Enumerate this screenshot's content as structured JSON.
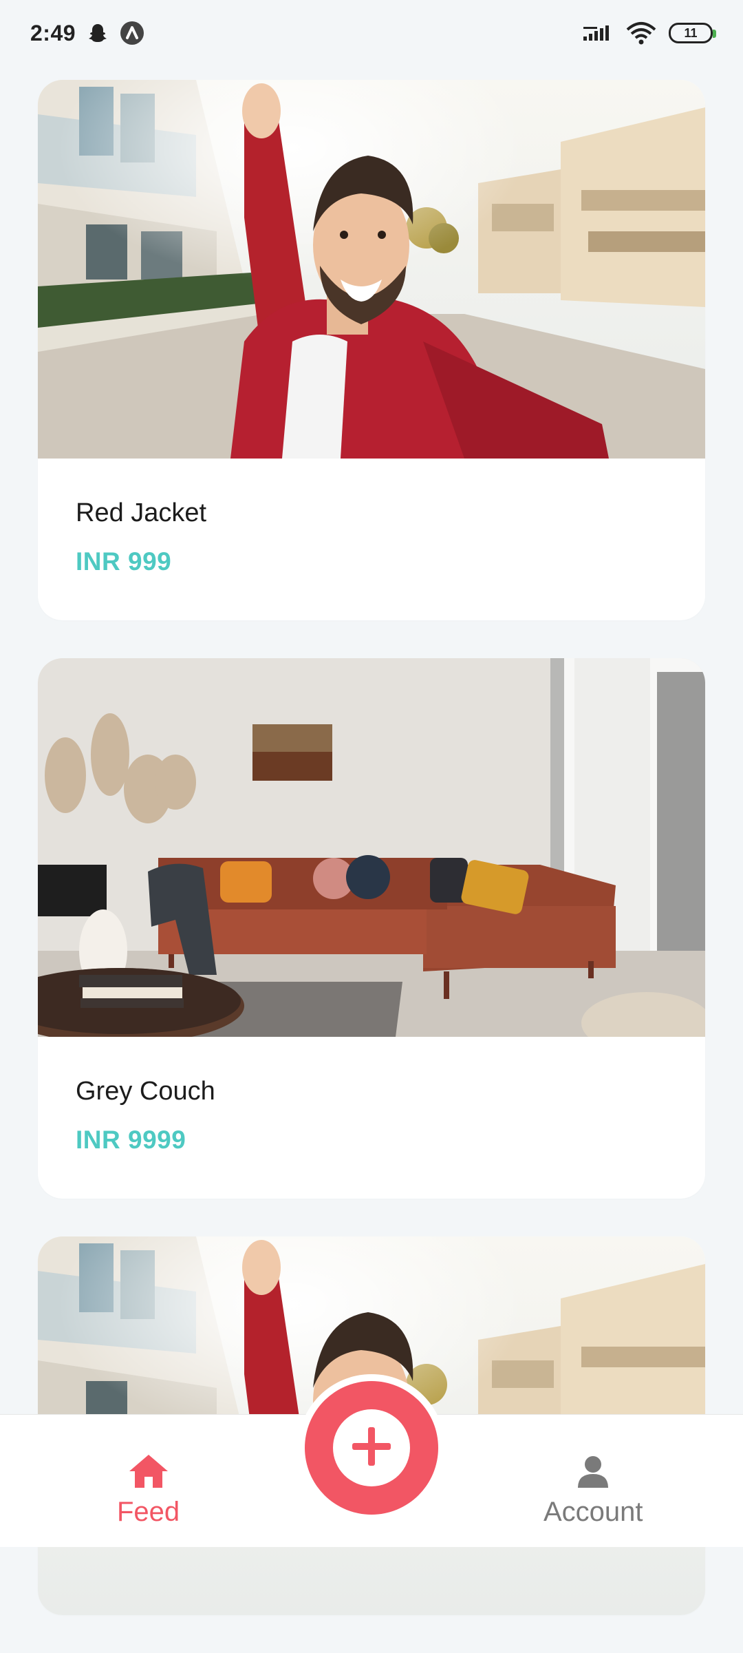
{
  "status_bar": {
    "time": "2:49",
    "battery_level": "11",
    "icons": [
      "snapchat-ghost-icon",
      "app-notification-icon",
      "signal-icon",
      "wifi-icon",
      "battery-icon"
    ]
  },
  "feed": {
    "items": [
      {
        "title": "Red Jacket",
        "price": "INR 999",
        "image": "man-red-jacket-selfie-photo"
      },
      {
        "title": "Grey Couch",
        "price": "INR 9999",
        "image": "living-room-couch-photo"
      },
      {
        "title": "",
        "price": "",
        "image": "man-red-jacket-selfie-photo"
      }
    ]
  },
  "bottom_nav": {
    "feed_label": "Feed",
    "account_label": "Account",
    "active_color": "#f25664",
    "inactive_color": "#7a7a7a"
  },
  "colors": {
    "accent": "#f25664",
    "price": "#4ec9c2",
    "background": "#f3f6f8"
  }
}
